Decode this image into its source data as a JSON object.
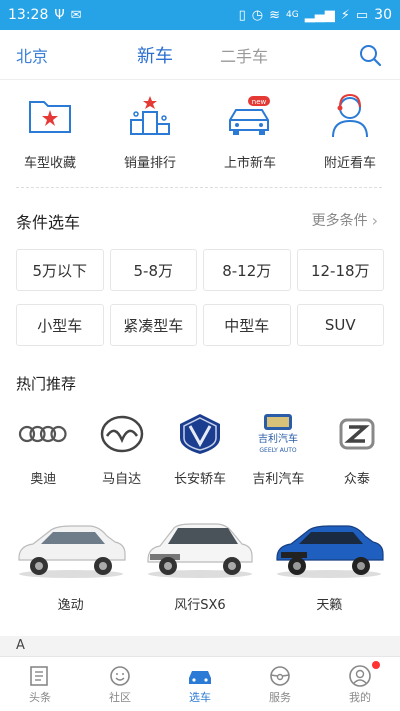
{
  "status": {
    "time": "13:28",
    "signal_label": "4G",
    "battery": "30"
  },
  "nav": {
    "city": "北京",
    "tab_new": "新车",
    "tab_used": "二手车"
  },
  "shortcuts": [
    {
      "label": "车型收藏",
      "icon": "folder-star-icon"
    },
    {
      "label": "销量排行",
      "icon": "podium-icon"
    },
    {
      "label": "上市新车",
      "icon": "new-car-icon",
      "badge": "new"
    },
    {
      "label": "附近看车",
      "icon": "person-headset-icon"
    }
  ],
  "filter": {
    "title": "条件选车",
    "more": "更多条件",
    "price": [
      "5万以下",
      "5-8万",
      "8-12万",
      "12-18万"
    ],
    "type": [
      "小型车",
      "紧凑型车",
      "中型车",
      "SUV"
    ]
  },
  "hot": {
    "title": "热门推荐",
    "brands": [
      {
        "label": "奥迪",
        "icon": "audi-logo"
      },
      {
        "label": "马自达",
        "icon": "mazda-logo"
      },
      {
        "label": "长安轿车",
        "icon": "changan-logo"
      },
      {
        "label": "吉利汽车",
        "icon": "geely-logo",
        "logo_text_cn": "吉利汽车",
        "logo_text_en": "GEELY AUTO"
      },
      {
        "label": "众泰",
        "icon": "zotye-logo"
      }
    ],
    "cars": [
      {
        "label": "逸动",
        "color": "#f2f2f2"
      },
      {
        "label": "风行SX6",
        "color": "#f5f5f5"
      },
      {
        "label": "天籁",
        "color": "#1f5fbf"
      }
    ]
  },
  "alpha_index": "A",
  "bottom_nav": [
    {
      "label": "头条",
      "icon": "newspaper-icon",
      "active": false
    },
    {
      "label": "社区",
      "icon": "chat-face-icon",
      "active": false
    },
    {
      "label": "选车",
      "icon": "car-icon",
      "active": true
    },
    {
      "label": "服务",
      "icon": "steering-wheel-icon",
      "active": false
    },
    {
      "label": "我的",
      "icon": "user-icon",
      "active": false
    }
  ],
  "colors": {
    "accent": "#2b7bd6",
    "status_bar": "#26a3e6",
    "star": "#e53935"
  }
}
